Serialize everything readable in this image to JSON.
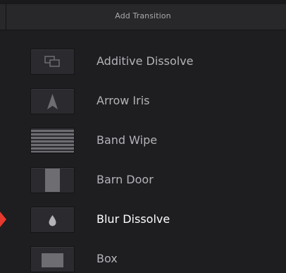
{
  "dialog": {
    "title": "Add Transition"
  },
  "transitions": [
    {
      "label": "Additive Dissolve",
      "icon": "overlapping-rectangles-icon"
    },
    {
      "label": "Arrow Iris",
      "icon": "arrow-up-icon"
    },
    {
      "label": "Band Wipe",
      "icon": "horizontal-bands-icon"
    },
    {
      "label": "Barn Door",
      "icon": "barn-door-icon"
    },
    {
      "label": "Blur Dissolve",
      "icon": "droplet-icon",
      "selected": true
    },
    {
      "label": "Box",
      "icon": "box-icon"
    }
  ],
  "colors": {
    "selection_marker": "#e8392f",
    "selected_text": "#ffffff",
    "text": "#b4b4b8"
  }
}
